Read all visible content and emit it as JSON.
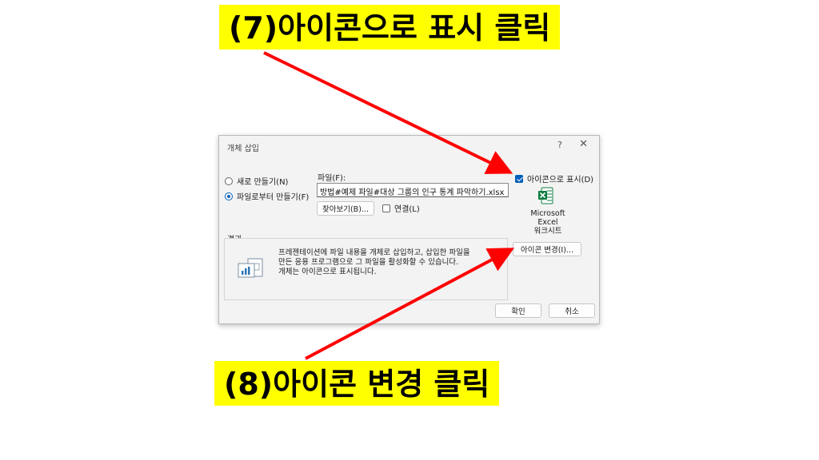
{
  "callouts": {
    "top": "(7)아이콘으로 표시 클릭",
    "bottom": "(8)아이콘 변경 클릭"
  },
  "dialog": {
    "title": "개체 삽입",
    "help": "?",
    "close": "✕",
    "radio_new": "새로 만들기(N)",
    "radio_file": "파일로부터 만들기(F)",
    "file_label": "파일(F):",
    "file_path": "방법#예제 파일#대상 그룹의 인구 통계 파악하기.xlsx",
    "browse_label": "찾아보기(B)...",
    "link_label": "연결(L)",
    "display_icon_label": "아이콘으로 표시(D)",
    "display_icon_checked": true,
    "icon_caption": [
      "Microsoft",
      "Excel",
      "워크시트"
    ],
    "icon_change_label": "아이콘 변경(I)...",
    "result_label": "결과",
    "result_lines": [
      "프레젠테이션에 파일 내용을 개체로 삽입하고, 삽입한 파일을",
      "만든 응용 프로그램으로 그 파일을 활성화할 수 있습니다.",
      "개체는 아이콘으로 표시됩니다."
    ],
    "ok_label": "확인",
    "cancel_label": "취소"
  },
  "colors": {
    "callout_bg": "#ffff00",
    "arrow": "#ff0000",
    "accent": "#005fb8",
    "excel_green": "#107c41"
  }
}
